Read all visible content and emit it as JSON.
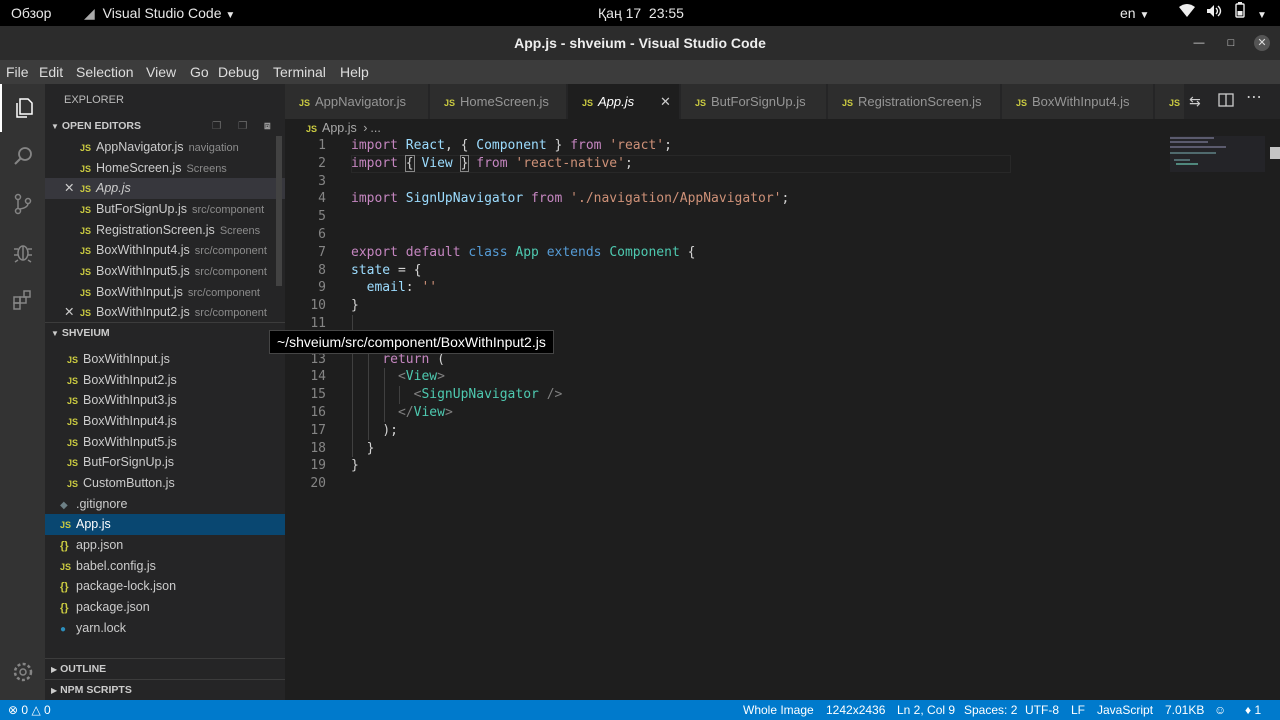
{
  "system_bar": {
    "activities": "Обзор",
    "app_menu": "Visual Studio Code",
    "date": "Қаң 17",
    "time": "23:55",
    "lang": "en"
  },
  "window": {
    "title": "App.js - shveium - Visual Studio Code"
  },
  "menu": [
    "File",
    "Edit",
    "Selection",
    "View",
    "Go",
    "Debug",
    "Terminal",
    "Help"
  ],
  "explorer": {
    "title": "EXPLORER",
    "open_editors_title": "OPEN EDITORS",
    "open_editors": [
      {
        "name": "AppNavigator.js",
        "path": "navigation"
      },
      {
        "name": "HomeScreen.js",
        "path": "Screens"
      },
      {
        "name": "App.js",
        "path": ""
      },
      {
        "name": "ButForSignUp.js",
        "path": "src/component"
      },
      {
        "name": "RegistrationScreen.js",
        "path": "Screens"
      },
      {
        "name": "BoxWithInput4.js",
        "path": "src/component"
      },
      {
        "name": "BoxWithInput5.js",
        "path": "src/component"
      },
      {
        "name": "BoxWithInput.js",
        "path": "src/component"
      },
      {
        "name": "BoxWithInput2.js",
        "path": "src/component"
      }
    ],
    "project_title": "SHVEIUM",
    "component_files": [
      "BoxWithInput.js",
      "BoxWithInput2.js",
      "BoxWithInput3.js",
      "BoxWithInput4.js",
      "BoxWithInput5.js",
      "ButForSignUp.js",
      "CustomButton.js"
    ],
    "root_files": [
      {
        "name": ".gitignore",
        "icon": "diamond-icon"
      },
      {
        "name": "App.js",
        "icon": "JS"
      },
      {
        "name": "app.json",
        "icon": "{}"
      },
      {
        "name": "babel.config.js",
        "icon": "JS"
      },
      {
        "name": "package-lock.json",
        "icon": "{}"
      },
      {
        "name": "package.json",
        "icon": "{}"
      },
      {
        "name": "yarn.lock",
        "icon": "yarn-icon"
      }
    ],
    "outline_title": "OUTLINE",
    "npm_title": "NPM SCRIPTS"
  },
  "tabs": [
    "AppNavigator.js",
    "HomeScreen.js",
    "App.js",
    "ButForSignUp.js",
    "RegistrationScreen.js",
    "BoxWithInput4.js",
    "JS"
  ],
  "breadcrumb": {
    "file": "App.js",
    "more": "..."
  },
  "tooltip": "~/shveium/src/component/BoxWithInput2.js",
  "code_line_numbers": [
    "1",
    "2",
    "3",
    "4",
    "5",
    "6",
    "7",
    "8",
    "9",
    "10",
    "11",
    "12",
    "13",
    "14",
    "15",
    "16",
    "17",
    "18",
    "19",
    "20"
  ],
  "code": {
    "l1": [
      "import",
      "React",
      ",",
      "{",
      "Component",
      "}",
      "from",
      "'react'",
      ";"
    ],
    "l2": [
      "import",
      "{",
      "View",
      "}",
      "from",
      "'react-native'",
      ";"
    ],
    "l4": [
      "import",
      "SignUpNavigator",
      "from",
      "'./navigation/AppNavigator'",
      ";"
    ],
    "l7": [
      "export",
      "default",
      "class",
      "App",
      "extends",
      "Component",
      "{"
    ],
    "l8": [
      "state",
      "=",
      "{"
    ],
    "l9": [
      "email",
      ":",
      "''"
    ],
    "l10": [
      "}"
    ],
    "l13": [
      "return",
      "("
    ],
    "l14": [
      "<",
      "View",
      ">"
    ],
    "l15": [
      "<",
      "SignUpNavigator",
      "/>"
    ],
    "l16": [
      "</",
      "View",
      ">"
    ],
    "l17": [
      ");"
    ],
    "l18": [
      "}"
    ],
    "l19": [
      "}"
    ]
  },
  "status": {
    "problems_errors": "0",
    "problems_warnings": "0",
    "whole_image": "Whole Image",
    "dimensions": "1242x2436",
    "position": "Ln 2, Col 9",
    "spaces": "Spaces: 2",
    "encoding": "UTF-8",
    "eol": "LF",
    "language": "JavaScript",
    "size": "7.01KB",
    "notifications": "1"
  },
  "colors": {
    "accent": "#007acc",
    "editor_bg": "#1e1e1e",
    "sidebar_bg": "#252526",
    "js_icon": "#cbcb41"
  }
}
